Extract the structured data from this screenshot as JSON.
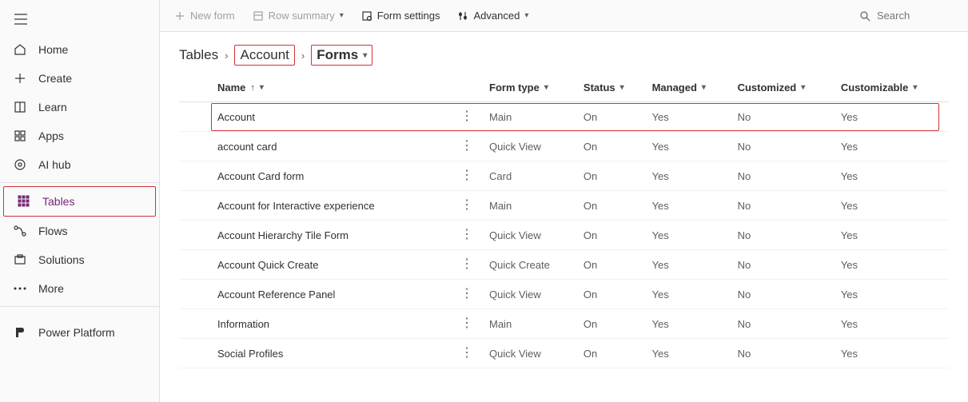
{
  "sidebar": {
    "items": [
      {
        "label": "Home"
      },
      {
        "label": "Create"
      },
      {
        "label": "Learn"
      },
      {
        "label": "Apps"
      },
      {
        "label": "AI hub"
      },
      {
        "label": "Tables"
      },
      {
        "label": "Flows"
      },
      {
        "label": "Solutions"
      },
      {
        "label": "More"
      },
      {
        "label": "Power Platform"
      }
    ]
  },
  "cmdbar": {
    "new_form": "New form",
    "row_summary": "Row summary",
    "form_settings": "Form settings",
    "advanced": "Advanced"
  },
  "search": {
    "placeholder": "Search"
  },
  "breadcrumb": {
    "tables": "Tables",
    "account": "Account",
    "forms": "Forms"
  },
  "table": {
    "cols": {
      "name": "Name",
      "form_type": "Form type",
      "status": "Status",
      "managed": "Managed",
      "customized": "Customized",
      "customizable": "Customizable"
    },
    "rows": [
      {
        "name": "Account",
        "form_type": "Main",
        "status": "On",
        "managed": "Yes",
        "customized": "No",
        "customizable": "Yes"
      },
      {
        "name": "account card",
        "form_type": "Quick View",
        "status": "On",
        "managed": "Yes",
        "customized": "No",
        "customizable": "Yes"
      },
      {
        "name": "Account Card form",
        "form_type": "Card",
        "status": "On",
        "managed": "Yes",
        "customized": "No",
        "customizable": "Yes"
      },
      {
        "name": "Account for Interactive experience",
        "form_type": "Main",
        "status": "On",
        "managed": "Yes",
        "customized": "No",
        "customizable": "Yes"
      },
      {
        "name": "Account Hierarchy Tile Form",
        "form_type": "Quick View",
        "status": "On",
        "managed": "Yes",
        "customized": "No",
        "customizable": "Yes"
      },
      {
        "name": "Account Quick Create",
        "form_type": "Quick Create",
        "status": "On",
        "managed": "Yes",
        "customized": "No",
        "customizable": "Yes"
      },
      {
        "name": "Account Reference Panel",
        "form_type": "Quick View",
        "status": "On",
        "managed": "Yes",
        "customized": "No",
        "customizable": "Yes"
      },
      {
        "name": "Information",
        "form_type": "Main",
        "status": "On",
        "managed": "Yes",
        "customized": "No",
        "customizable": "Yes"
      },
      {
        "name": "Social Profiles",
        "form_type": "Quick View",
        "status": "On",
        "managed": "Yes",
        "customized": "No",
        "customizable": "Yes"
      }
    ]
  }
}
